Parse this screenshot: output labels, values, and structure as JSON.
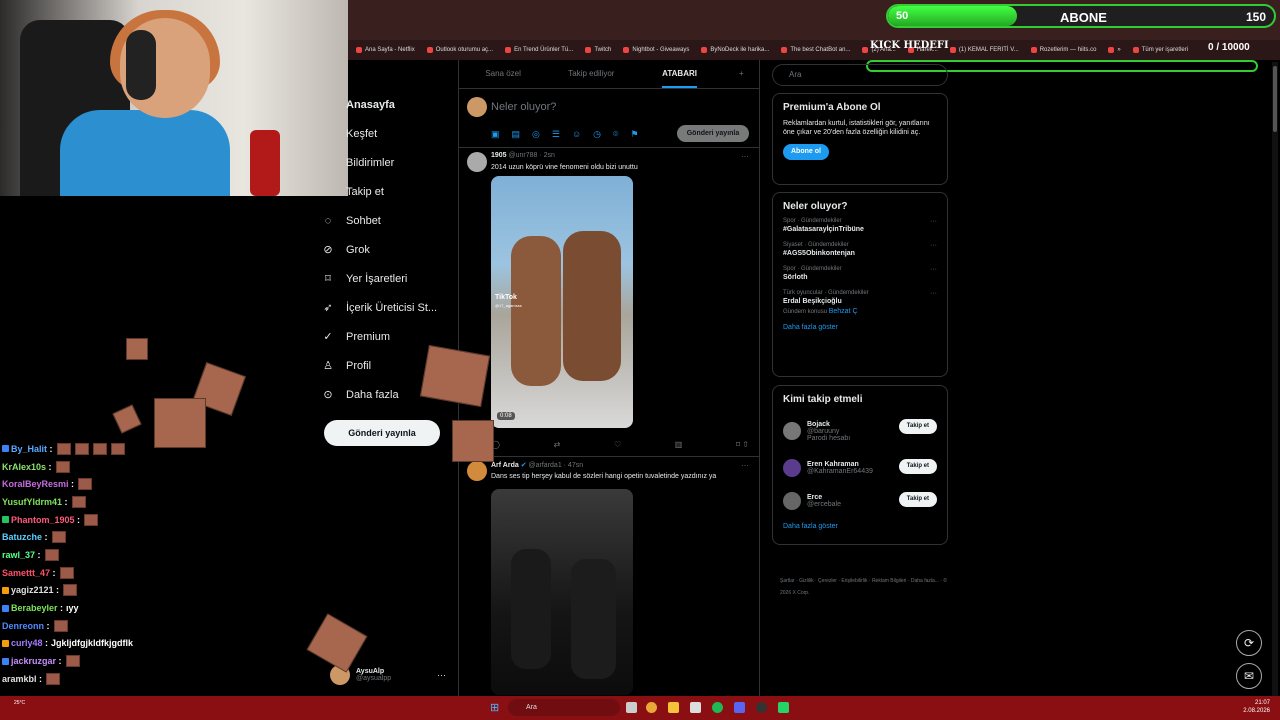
{
  "overlay": {
    "sub_current": "50",
    "sub_label": "ABONE",
    "sub_goal": "150",
    "sub_progress": 0.333,
    "kick_title": "KICK HEDEFI",
    "kick_count": "0 / 10000"
  },
  "bookmarks": [
    "Ana Sayfa - Netflix",
    "Outlook oturumu aç...",
    "En Trend Ürünler Tü...",
    "Twitch",
    "Nightbot - Giveaways",
    "ByNoDeck ile harika...",
    "The best ChatBot an...",
    "(2) Ana...",
    "Harek...",
    "(1) KEMAL FERITİ V...",
    "Rozetlerim — hiits.co",
    "»",
    "Tüm yer işaretleri"
  ],
  "nav": {
    "items": [
      {
        "label": "Anasayfa",
        "icon": "home-icon"
      },
      {
        "label": "Keşfet",
        "icon": "search-icon"
      },
      {
        "label": "Bildirimler",
        "icon": "bell-icon"
      },
      {
        "label": "Takip et",
        "icon": "follow-icon"
      },
      {
        "label": "Sohbet",
        "icon": "chat-icon"
      },
      {
        "label": "Grok",
        "icon": "grok-icon"
      },
      {
        "label": "Yer İşaretleri",
        "icon": "bookmark-icon"
      },
      {
        "label": "İçerik Üreticisi St...",
        "icon": "creator-icon"
      },
      {
        "label": "Premium",
        "icon": "premium-icon"
      },
      {
        "label": "Profil",
        "icon": "profile-icon"
      },
      {
        "label": "Daha fazla",
        "icon": "more-icon"
      }
    ],
    "post_button": "Gönderi yayınla",
    "account_name": "AysuAlp",
    "account_handle": "@aysualpp"
  },
  "feed": {
    "tabs": [
      "Sana özel",
      "Takip ediliyor",
      "ATABARI",
      "+"
    ],
    "compose_placeholder": "Neler oluyor?",
    "compose_button": "Gönderi yayınla",
    "tweets": [
      {
        "name": "1905",
        "handle": "@unr788 · 2sn",
        "text": "2014 uzun köprü vine fenomeni oldu bizi unuttu",
        "duration": "0:08",
        "watermark": "TikTok",
        "watermark_user": "@17_agamsss"
      },
      {
        "name": "Arf Arda",
        "handle": "@arfarda1 · 47sn",
        "text": "Dans ses tip herşey kabul de sözleri hangi opetin tuvaletinde yazdınız ya"
      }
    ]
  },
  "right": {
    "search_placeholder": "Ara",
    "premium": {
      "title": "Premium'a Abone Ol",
      "text": "Reklamlardan kurtul, istatistikleri gör, yanıtlarını öne çıkar ve 20'den fazla özelliğin kilidini aç.",
      "button": "Abone ol"
    },
    "trends": {
      "title": "Neler oluyor?",
      "items": [
        {
          "meta": "Spor · Gündemdekiler",
          "name": "#GalatasarayİçinTribüne"
        },
        {
          "meta": "Siyaset · Gündemdekiler",
          "name": "#AGS5Obinkontenjan"
        },
        {
          "meta": "Spor · Gündemdekiler",
          "name": "Sörloth"
        },
        {
          "meta": "Türk oyuncular · Gündemdekiler",
          "name": "Erdal Beşikçioğlu",
          "sub": "Gündem konusu",
          "sub_link": "Behzat Ç"
        }
      ],
      "more": "Daha fazla göster"
    },
    "who": {
      "title": "Kimi takip etmeli",
      "items": [
        {
          "name": "Bojack",
          "handle": "@baruuny",
          "extra": "Parodi hesabı",
          "button": "Takip et"
        },
        {
          "name": "Eren Kahraman",
          "handle": "@KahramanEr64439",
          "button": "Takip et"
        },
        {
          "name": "Erce",
          "handle": "@ercebale",
          "button": "Takip et"
        }
      ],
      "more": "Daha fazla göster"
    },
    "footer": "Şartlar · Gizlilik · Çerezler · Erişilebilirlik · Reklam Bilgileri · Daha fazla... · © 2026 X Corp."
  },
  "chat": [
    {
      "user": "By_Halit",
      "color": "#5aa9ff",
      "text": "",
      "emotes": 4
    },
    {
      "user": "KrAlex10s",
      "color": "#8ce36b",
      "text": "",
      "emotes": 1
    },
    {
      "user": "KoralBeyResmi",
      "color": "#c76ce0",
      "text": "",
      "emotes": 1
    },
    {
      "user": "YusufYldrm41",
      "color": "#7ee35a",
      "text": "",
      "emotes": 1
    },
    {
      "user": "Phantom_1905",
      "color": "#ff5a7a",
      "text": "",
      "emotes": 1
    },
    {
      "user": "Batuzche",
      "color": "#5ad0ff",
      "text": "",
      "emotes": 1
    },
    {
      "user": "rawl_37",
      "color": "#5aff8c",
      "text": "",
      "emotes": 1
    },
    {
      "user": "Samettt_47",
      "color": "#ff4f6a",
      "text": "",
      "emotes": 1
    },
    {
      "user": "yagiz2121",
      "color": "#e0e0e0",
      "text": "",
      "emotes": 1
    },
    {
      "user": "Berabeyler",
      "color": "#7ee35a",
      "text": "ıyy",
      "emotes": 0
    },
    {
      "user": "Denreonn",
      "color": "#4f8aff",
      "text": "",
      "emotes": 1
    },
    {
      "user": "curly48",
      "color": "#a47cff",
      "text": "Jgkljdfgjkldfkjgdflk",
      "emotes": 0
    },
    {
      "user": "jackruzgar",
      "color": "#c68cff",
      "text": "",
      "emotes": 1
    },
    {
      "user": "aramkbl",
      "color": "#e0e0e0",
      "text": "",
      "emotes": 1
    }
  ],
  "taskbar": {
    "search": "Ara",
    "weather": "25°C",
    "time": "21:07",
    "date": "2.08.2026"
  },
  "colors": {
    "accent": "#1d9bf0",
    "taskbar": "#8a0f12",
    "sub_bar": "#33cc33"
  }
}
